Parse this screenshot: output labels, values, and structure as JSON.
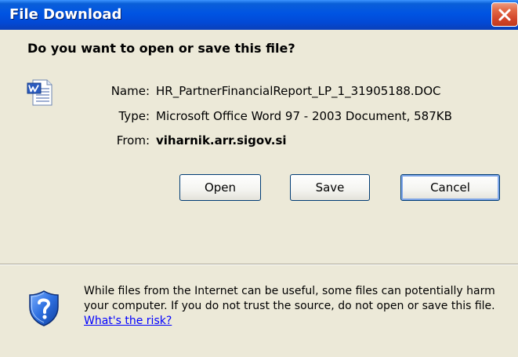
{
  "window": {
    "title": "File Download"
  },
  "dialog": {
    "question": "Do you want to open or save this file?",
    "file": {
      "name_label": "Name:",
      "name_value": "HR_PartnerFinancialReport_LP_1_31905188.DOC",
      "type_label": "Type:",
      "type_value": "Microsoft Office Word 97 - 2003 Document, 587KB",
      "from_label": "From:",
      "from_value": "viharnik.arr.sigov.si"
    },
    "buttons": {
      "open": "Open",
      "save": "Save",
      "cancel": "Cancel"
    },
    "warning": {
      "text": "While files from the Internet can be useful, some files can potentially harm your computer. If you do not trust the source, do not open or save this file.",
      "link": "What's the risk?"
    }
  },
  "icons": {
    "file_icon": "word-document-icon",
    "warning_icon": "shield-question-icon",
    "close_icon": "close-icon"
  },
  "colors": {
    "titlebar": "#0054e3",
    "dialog_bg": "#ece9d8",
    "close_button": "#e36a47",
    "link": "#0000ff"
  }
}
